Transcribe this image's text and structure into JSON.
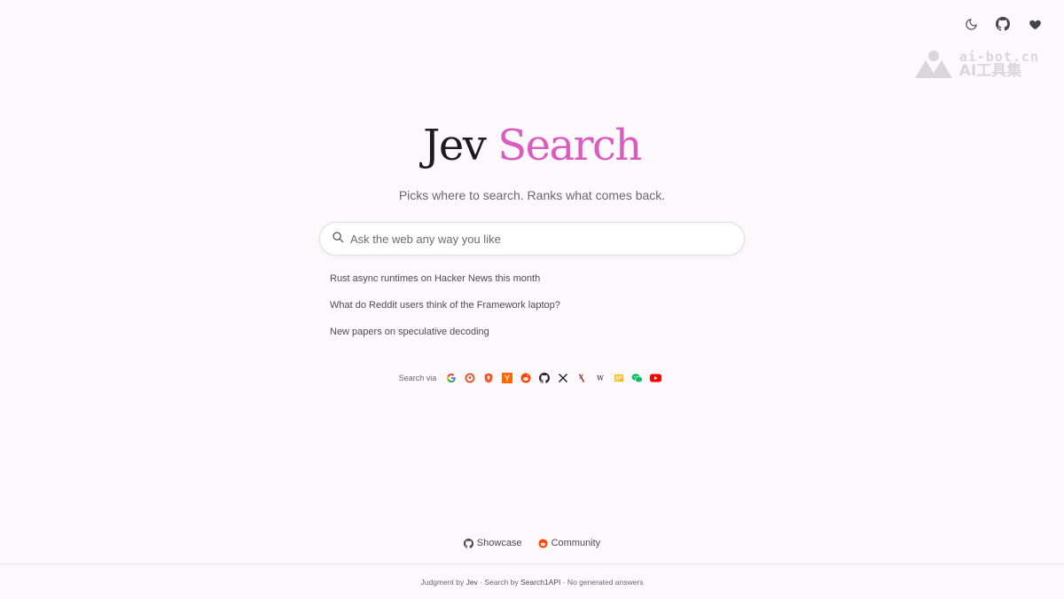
{
  "header": {
    "icons": [
      "moon-icon",
      "github-icon",
      "heart-icon"
    ]
  },
  "watermark": {
    "top": "ai-bot.cn",
    "bottom": "AI工具集"
  },
  "hero": {
    "title_part1": "Jev",
    "title_part2": "Search",
    "subtitle": "Picks where to search. Ranks what comes back."
  },
  "search": {
    "placeholder": "Ask the web any way you like",
    "value": ""
  },
  "suggestions": [
    "Rust async runtimes on Hacker News this month",
    "What do Reddit users think of the Framework laptop?",
    "New papers on speculative decoding"
  ],
  "search_via": {
    "label": "Search via",
    "engines": [
      "google",
      "duckduckgo",
      "brave",
      "hacker-news",
      "reddit",
      "github",
      "x",
      "arxiv",
      "wikipedia",
      "stack-exchange",
      "wechat",
      "youtube"
    ]
  },
  "footer": {
    "links": {
      "showcase": "Showcase",
      "community": "Community"
    },
    "note": {
      "p1": "Judgment by ",
      "jev": "Jev",
      "p2": " · Search by ",
      "api": "Search1API",
      "p3": " · No generated answers"
    }
  },
  "colors": {
    "background": "#fdf8fc",
    "accent": "#d85dbf",
    "title_dark": "#1d1a20"
  }
}
